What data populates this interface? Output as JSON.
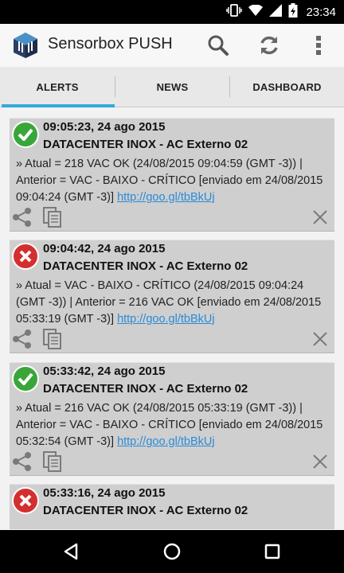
{
  "status_bar": {
    "time": "23:34"
  },
  "app": {
    "title": "Sensorbox PUSH"
  },
  "actions": {
    "search": "search-icon",
    "refresh": "refresh-icon",
    "overflow": "more-vert-icon"
  },
  "tabs": [
    {
      "label": "ALERTS",
      "selected": true
    },
    {
      "label": "NEWS",
      "selected": false
    },
    {
      "label": "DASHBOARD",
      "selected": false
    }
  ],
  "colors": {
    "accent": "#33aadd",
    "ok": "#3aa63a",
    "error": "#d32f2f",
    "link": "#2a8bd6"
  },
  "alerts": [
    {
      "status": "ok",
      "time": "09:05:23, 24 ago 2015",
      "title": "DATACENTER INOX - AC Externo 02",
      "message": " » Atual = 218 VAC OK (24/08/2015 09:04:59 (GMT -3)) | Anterior = VAC - BAIXO - CRÍTICO [enviado em 24/08/2015 09:04:24 (GMT -3)] ",
      "link": "http://goo.gl/tbBkUj"
    },
    {
      "status": "error",
      "time": "09:04:42, 24 ago 2015",
      "title": "DATACENTER INOX - AC Externo 02",
      "message": " » Atual = VAC - BAIXO - CRÍTICO (24/08/2015 09:04:24 (GMT -3)) | Anterior = 216 VAC OK [enviado em 24/08/2015 05:33:19 (GMT -3)] ",
      "link": "http://goo.gl/tbBkUj"
    },
    {
      "status": "ok",
      "time": "05:33:42, 24 ago 2015",
      "title": "DATACENTER INOX - AC Externo 02",
      "message": " » Atual = 216 VAC OK (24/08/2015 05:33:19 (GMT -3)) | Anterior = VAC - BAIXO - CRÍTICO [enviado em 24/08/2015 05:32:54 (GMT -3)] ",
      "link": "http://goo.gl/tbBkUj"
    },
    {
      "status": "error",
      "time": "05:33:16, 24 ago 2015",
      "title": "DATACENTER INOX - AC Externo 02"
    }
  ]
}
